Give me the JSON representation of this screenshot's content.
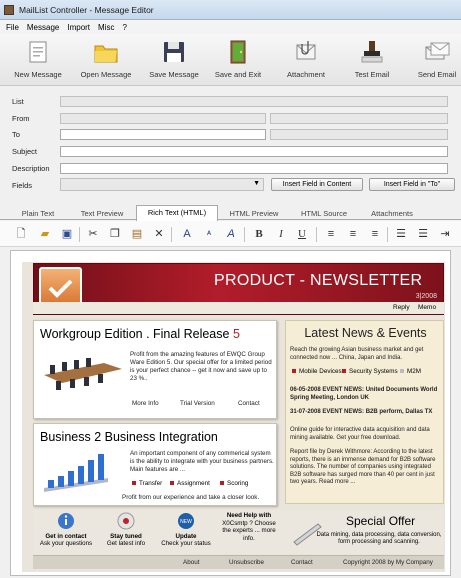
{
  "window": {
    "title": "MailList Controller - Message Editor"
  },
  "menu": [
    "File",
    "Message",
    "Import",
    "Misc",
    "?"
  ],
  "toolbar": [
    {
      "label": "New Message",
      "icon": "new-message-icon"
    },
    {
      "label": "Open Message",
      "icon": "open-folder-icon"
    },
    {
      "label": "Save Message",
      "icon": "floppy-disk-icon"
    },
    {
      "label": "Save and Exit",
      "icon": "exit-door-icon"
    },
    {
      "label": "Attachment",
      "icon": "attachment-icon"
    },
    {
      "label": "Test Email",
      "icon": "test-stamp-icon"
    },
    {
      "label": "Send Email",
      "icon": "send-envelopes-icon"
    }
  ],
  "form": {
    "list_label": "List",
    "from_label": "From",
    "to_label": "To",
    "subject_label": "Subject",
    "description_label": "Description",
    "fields_label": "Fields",
    "insert_content": "Insert Field in Content",
    "insert_to": "Insert Field in \"To\""
  },
  "tabs": [
    {
      "label": "Plain Text",
      "active": false
    },
    {
      "label": "Text Preview",
      "active": false
    },
    {
      "label": "Rich Text (HTML)",
      "active": true
    },
    {
      "label": "HTML Preview",
      "active": false
    },
    {
      "label": "HTML Source",
      "active": false
    },
    {
      "label": "Attachments",
      "active": false
    }
  ],
  "newsletter": {
    "title": "PRODUCT - NEWSLETTER",
    "date": "3|2008",
    "reply": "Reply",
    "memo": "Memo",
    "card1": {
      "title": "Workgroup Edition . Final Release",
      "title_num": "5",
      "text": "Profit from the amazing features of EWQC Group Ware Edition 5. Our special offer for a limited period is your perfect chance -- get it now and save up to 23 %..",
      "links": [
        "More Info",
        "Trial Version",
        "Contact"
      ]
    },
    "card2": {
      "title": "Business 2 Business Integration",
      "text": "An important component of any commerical system is the ability to integrate with your business partners. Main features are ...",
      "bullets": [
        "Transfer",
        "Assignment",
        "Scoring"
      ],
      "footer": "Profit from our experience and take a closer look."
    },
    "latest": {
      "title": "Latest News & Events",
      "intro": "Reach the growing Asian business market and get connected now ... China, Japan and India.",
      "tags": [
        "Mobile Devices",
        "Security Systems",
        "M2M"
      ],
      "event1": "06-05-2008 EVENT NEWS: United Documents World Spring Meeting, London UK",
      "event2": "31-07-2008 EVENT NEWS: B2B perform, Dallas TX",
      "guide": "Online guide for interactive  data acquisition and data mining available. Get your free download.",
      "report": "Report  file by Derek Withmore: According to the latest reports, there is an immense demand for B2B software solutions. The number of companies using integrated B2B software has surged more than 40 per cent in just two years. Read more ..."
    },
    "bottom": [
      {
        "title": "Get in contact",
        "sub": "Ask your questions"
      },
      {
        "title": "Stay tuned",
        "sub": "Get latest info"
      },
      {
        "title": "Update",
        "sub": "Check your status"
      },
      {
        "title": "Need Help with",
        "sub": "X0Csmtp ? Choose the experts ... more info."
      }
    ],
    "special": {
      "title": "Special Offer",
      "text": "Data mining, data processing, data conversion, form processing and scanning."
    },
    "footer": [
      "About",
      "Unsubscribe",
      "Contact",
      "Copyright 2008 by My Company"
    ]
  },
  "colors": {
    "accent": "#b21d2a",
    "latest_bg": "#f6edd7"
  }
}
